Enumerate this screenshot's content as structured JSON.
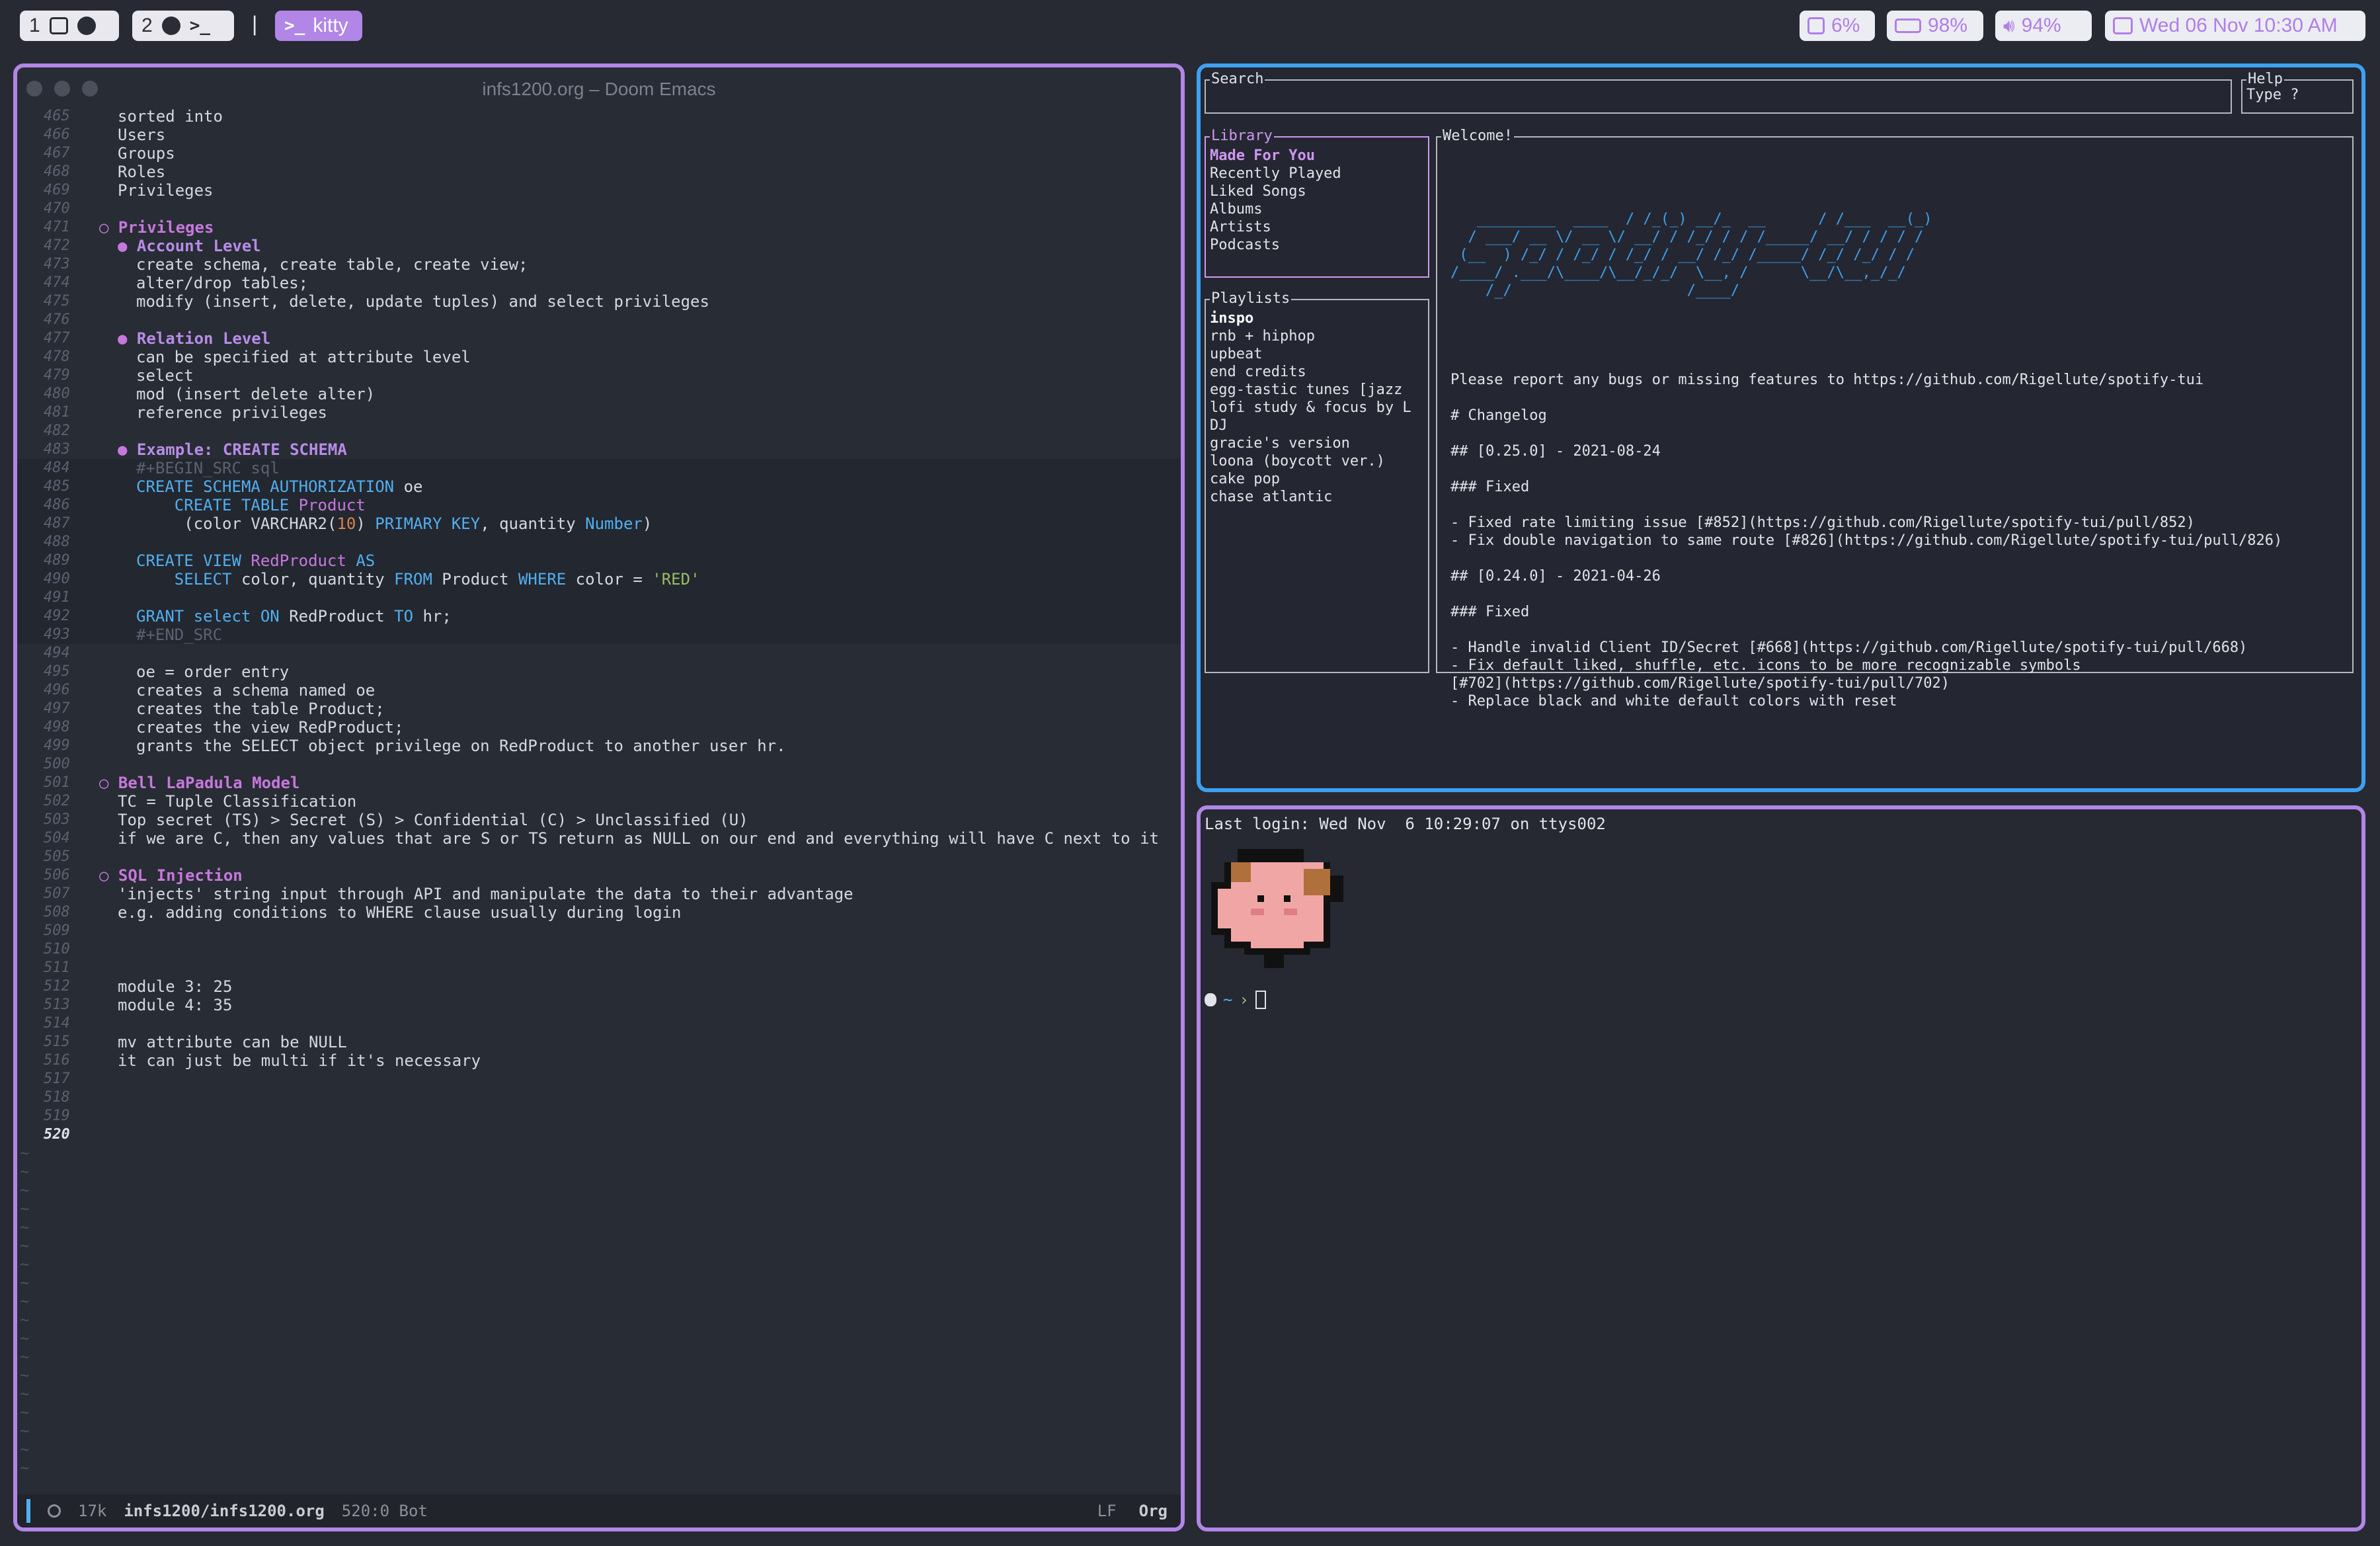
{
  "topbar": {
    "workspace1": "1",
    "workspace2": "2",
    "separator": "|",
    "active_app": "kitty",
    "cpu": "6%",
    "battery": "98%",
    "volume": "94%",
    "datetime": "Wed 06 Nov 10:30 AM"
  },
  "emacs": {
    "title": "infs1200.org – Doom Emacs",
    "modeline": {
      "size": "17k",
      "file": "infs1200/infs1200.org",
      "pos": "520:0 Bot",
      "eol": "LF",
      "mode": "Org"
    },
    "lines": [
      {
        "n": "465",
        "t": "sorted into",
        "i": 0
      },
      {
        "n": "466",
        "t": "Users",
        "i": 0
      },
      {
        "n": "467",
        "t": "Groups",
        "i": 0
      },
      {
        "n": "468",
        "t": "Roles",
        "i": 0
      },
      {
        "n": "469",
        "t": "Privileges",
        "i": 0
      },
      {
        "n": "470",
        "t": "",
        "i": 0
      },
      {
        "n": "471",
        "t": "Privileges",
        "i": 0,
        "k": "h2",
        "b": "○ "
      },
      {
        "n": "472",
        "t": "Account Level",
        "i": 1,
        "k": "h3",
        "b": "● "
      },
      {
        "n": "473",
        "t": "create schema, create table, create view;",
        "i": 1
      },
      {
        "n": "474",
        "t": "alter/drop tables;",
        "i": 1
      },
      {
        "n": "475",
        "t": "modify (insert, delete, update tuples) and select privileges",
        "i": 1
      },
      {
        "n": "476",
        "t": "",
        "i": 0
      },
      {
        "n": "477",
        "t": "Relation Level",
        "i": 1,
        "k": "h3",
        "b": "● "
      },
      {
        "n": "478",
        "t": "can be specified at attribute level",
        "i": 1
      },
      {
        "n": "479",
        "t": "select",
        "i": 1
      },
      {
        "n": "480",
        "t": "mod (insert delete alter)",
        "i": 1
      },
      {
        "n": "481",
        "t": "reference privileges",
        "i": 1
      },
      {
        "n": "482",
        "t": "",
        "i": 0
      },
      {
        "n": "483",
        "t": "Example: CREATE SCHEMA",
        "i": 1,
        "k": "h3",
        "b": "● "
      },
      {
        "n": "484",
        "t": "#+BEGIN_SRC sql",
        "i": 1,
        "k": "cm",
        "s": 1
      },
      {
        "n": "485",
        "t": "",
        "i": 1,
        "s": 1,
        "h": "<span class=\"kw\">CREATE SCHEMA AUTHORIZATION</span> oe"
      },
      {
        "n": "486",
        "t": "",
        "i": 1,
        "s": 1,
        "h": "    <span class=\"kw\">CREATE TABLE</span> <span class=\"fn\">Product</span>"
      },
      {
        "n": "487",
        "t": "",
        "i": 1,
        "s": 1,
        "h": "     (color VARCHAR2(<span class=\"num2\">10</span>) <span class=\"kw\">PRIMARY KEY</span>, quantity <span class=\"kw\">Number</span>)"
      },
      {
        "n": "488",
        "t": "",
        "i": 1,
        "s": 1
      },
      {
        "n": "489",
        "t": "",
        "i": 1,
        "s": 1,
        "h": "<span class=\"kw\">CREATE VIEW</span> <span class=\"fn\">RedProduct</span> <span class=\"kw\">AS</span>"
      },
      {
        "n": "490",
        "t": "",
        "i": 1,
        "s": 1,
        "h": "    <span class=\"kw\">SELECT</span> color, quantity <span class=\"kw\">FROM</span> Product <span class=\"kw\">WHERE</span> color = <span class=\"str\">'RED'</span>"
      },
      {
        "n": "491",
        "t": "",
        "i": 1,
        "s": 1
      },
      {
        "n": "492",
        "t": "",
        "i": 1,
        "s": 1,
        "h": "<span class=\"kw\">GRANT</span> <span class=\"kw\">select</span> <span class=\"kw\">ON</span> RedProduct <span class=\"kw\">TO</span> hr;"
      },
      {
        "n": "493",
        "t": "#+END_SRC",
        "i": 1,
        "k": "cm",
        "s": 1
      },
      {
        "n": "494",
        "t": "",
        "i": 0
      },
      {
        "n": "495",
        "t": "oe = order entry",
        "i": 1
      },
      {
        "n": "496",
        "t": "creates a schema named oe",
        "i": 1
      },
      {
        "n": "497",
        "t": "creates the table Product;",
        "i": 1
      },
      {
        "n": "498",
        "t": "creates the view RedProduct;",
        "i": 1
      },
      {
        "n": "499",
        "t": "grants the SELECT object privilege on RedProduct to another user hr.",
        "i": 1
      },
      {
        "n": "500",
        "t": "",
        "i": 0
      },
      {
        "n": "501",
        "t": "Bell LaPadula Model",
        "i": 0,
        "k": "h2",
        "b": "○ "
      },
      {
        "n": "502",
        "t": "TC = Tuple Classification",
        "i": 0
      },
      {
        "n": "503",
        "t": "Top secret (TS) > Secret (S) > Confidential (C) > Unclassified (U)",
        "i": 0
      },
      {
        "n": "504",
        "t": "if we are C, then any values that are S or TS return as NULL on our end and everything will have C next to it",
        "i": 0
      },
      {
        "n": "505",
        "t": "",
        "i": 0
      },
      {
        "n": "506",
        "t": "SQL Injection",
        "i": 0,
        "k": "h2",
        "b": "○ "
      },
      {
        "n": "507",
        "t": "'injects' string input through API and manipulate the data to their advantage",
        "i": 0
      },
      {
        "n": "508",
        "t": "e.g. adding conditions to WHERE clause usually during login",
        "i": 0
      },
      {
        "n": "509",
        "t": "",
        "i": 0
      },
      {
        "n": "510",
        "t": "",
        "i": 0
      },
      {
        "n": "511",
        "t": "",
        "i": 0
      },
      {
        "n": "512",
        "t": "module 3: 25",
        "i": 0
      },
      {
        "n": "513",
        "t": "module 4: 35",
        "i": 0
      },
      {
        "n": "514",
        "t": "",
        "i": 0
      },
      {
        "n": "515",
        "t": "mv attribute can be NULL",
        "i": 0
      },
      {
        "n": "516",
        "t": "it can just be multi if it's necessary",
        "i": 0
      },
      {
        "n": "517",
        "t": "",
        "i": 0
      },
      {
        "n": "518",
        "t": "",
        "i": 0
      },
      {
        "n": "519",
        "t": "",
        "i": 0
      },
      {
        "n": "520",
        "t": "",
        "i": 0,
        "c": 1
      }
    ],
    "tilde": "~"
  },
  "spotify": {
    "search_label": "Search",
    "help_label": "Help",
    "help_text": "Type ?",
    "library_label": "Library",
    "library_items": [
      "Made For You",
      "Recently Played",
      "Liked Songs",
      "Albums",
      "Artists",
      "Podcasts"
    ],
    "playlists_label": "Playlists",
    "playlists": [
      "inspo",
      "rnb + hiphop",
      "upbeat",
      "end credits",
      "egg-tastic tunes [jazz",
      "lofi study & focus by L",
      "DJ",
      "gracie's version",
      "loona (boycott ver.)",
      "cake pop",
      "chase atlantic"
    ],
    "welcome_label": "Welcome!",
    "ascii_art": "   _________  ____  / /_(_) __/_  __      / /___  __(_)\n  / ___/ __ \\/ __ \\/ __/ / /_/ / / /_____/ __/ / / / /\n (__  ) /_/ / /_/ / /_/ / __/ /_/ /_____/ /_/ /_/ / /\n/____/ .___/\\____/\\__/_/_/  \\__, /      \\__/\\__,_/_/\n    /_/                    /____/",
    "welcome_text": "Please report any bugs or missing features to https://github.com/Rigellute/spotify-tui\n\n# Changelog\n\n## [0.25.0] - 2021-08-24\n\n### Fixed\n\n- Fixed rate limiting issue [#852](https://github.com/Rigellute/spotify-tui/pull/852)\n- Fix double navigation to same route [#826](https://github.com/Rigellute/spotify-tui/pull/826)\n\n## [0.24.0] - 2021-04-26\n\n### Fixed\n\n- Handle invalid Client ID/Secret [#668](https://github.com/Rigellute/spotify-tui/pull/668)\n- Fix default liked, shuffle, etc. icons to be more recognizable symbols\n[#702](https://github.com/Rigellute/spotify-tui/pull/702)\n- Replace black and white default colors with reset"
  },
  "terminal": {
    "last_login": "Last login: Wed Nov  6 10:29:07 on ttys002",
    "prompt_dir": "~",
    "prompt_arrow": "›"
  }
}
